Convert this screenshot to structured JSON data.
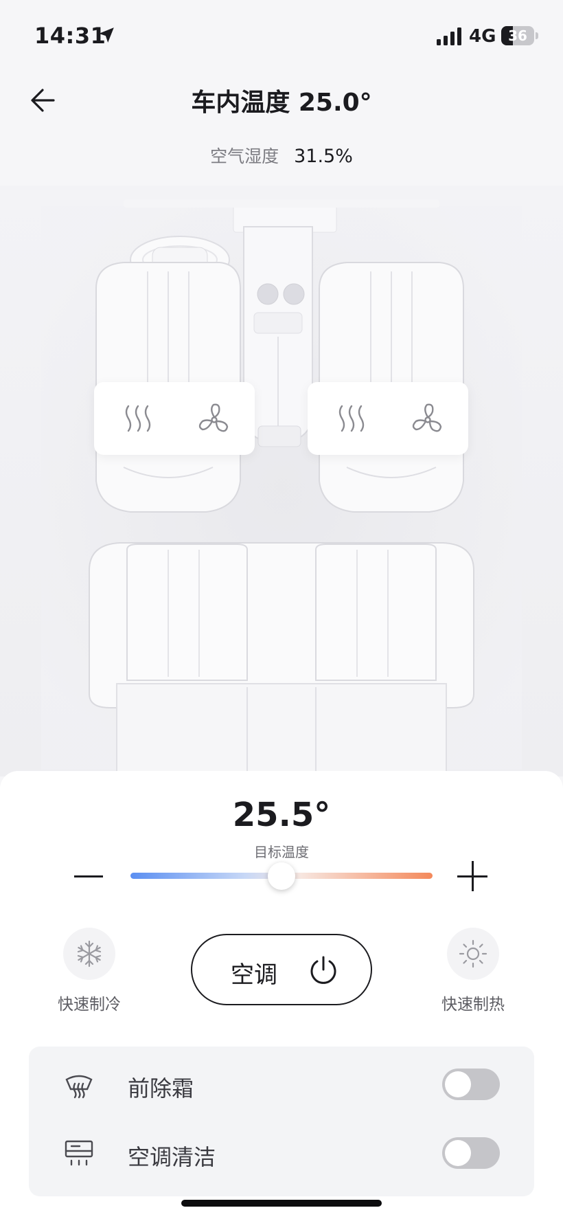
{
  "status_bar": {
    "time": "14:31",
    "network": "4G",
    "battery": "36",
    "battery_level": 0.36
  },
  "header": {
    "title": "车内温度 25.0°"
  },
  "humidity": {
    "label": "空气湿度",
    "value": "31.5%"
  },
  "seats": {
    "driver": {
      "heat_icon": "seat-heat-icon",
      "fan_icon": "seat-vent-fan-icon"
    },
    "passenger": {
      "heat_icon": "seat-heat-icon",
      "fan_icon": "seat-vent-fan-icon"
    }
  },
  "climate": {
    "target_temp": "25.5°",
    "target_label": "目标温度",
    "slider_level": 0.5,
    "quick_cool_label": "快速制冷",
    "quick_heat_label": "快速制热",
    "ac_label": "空调",
    "quick_cool_icon": "snowflake-icon",
    "quick_heat_icon": "sun-icon",
    "ac_icon": "power-icon"
  },
  "toggles": [
    {
      "label": "前除霜",
      "icon": "front-defrost-icon",
      "on": false
    },
    {
      "label": "空调清洁",
      "icon": "ac-clean-icon",
      "on": false
    }
  ],
  "colors": {
    "slider_cold": "#5b8ff2",
    "slider_hot": "#f4895b",
    "toggle_off": "#c5c5c9",
    "text_primary": "#1b1b1f"
  }
}
